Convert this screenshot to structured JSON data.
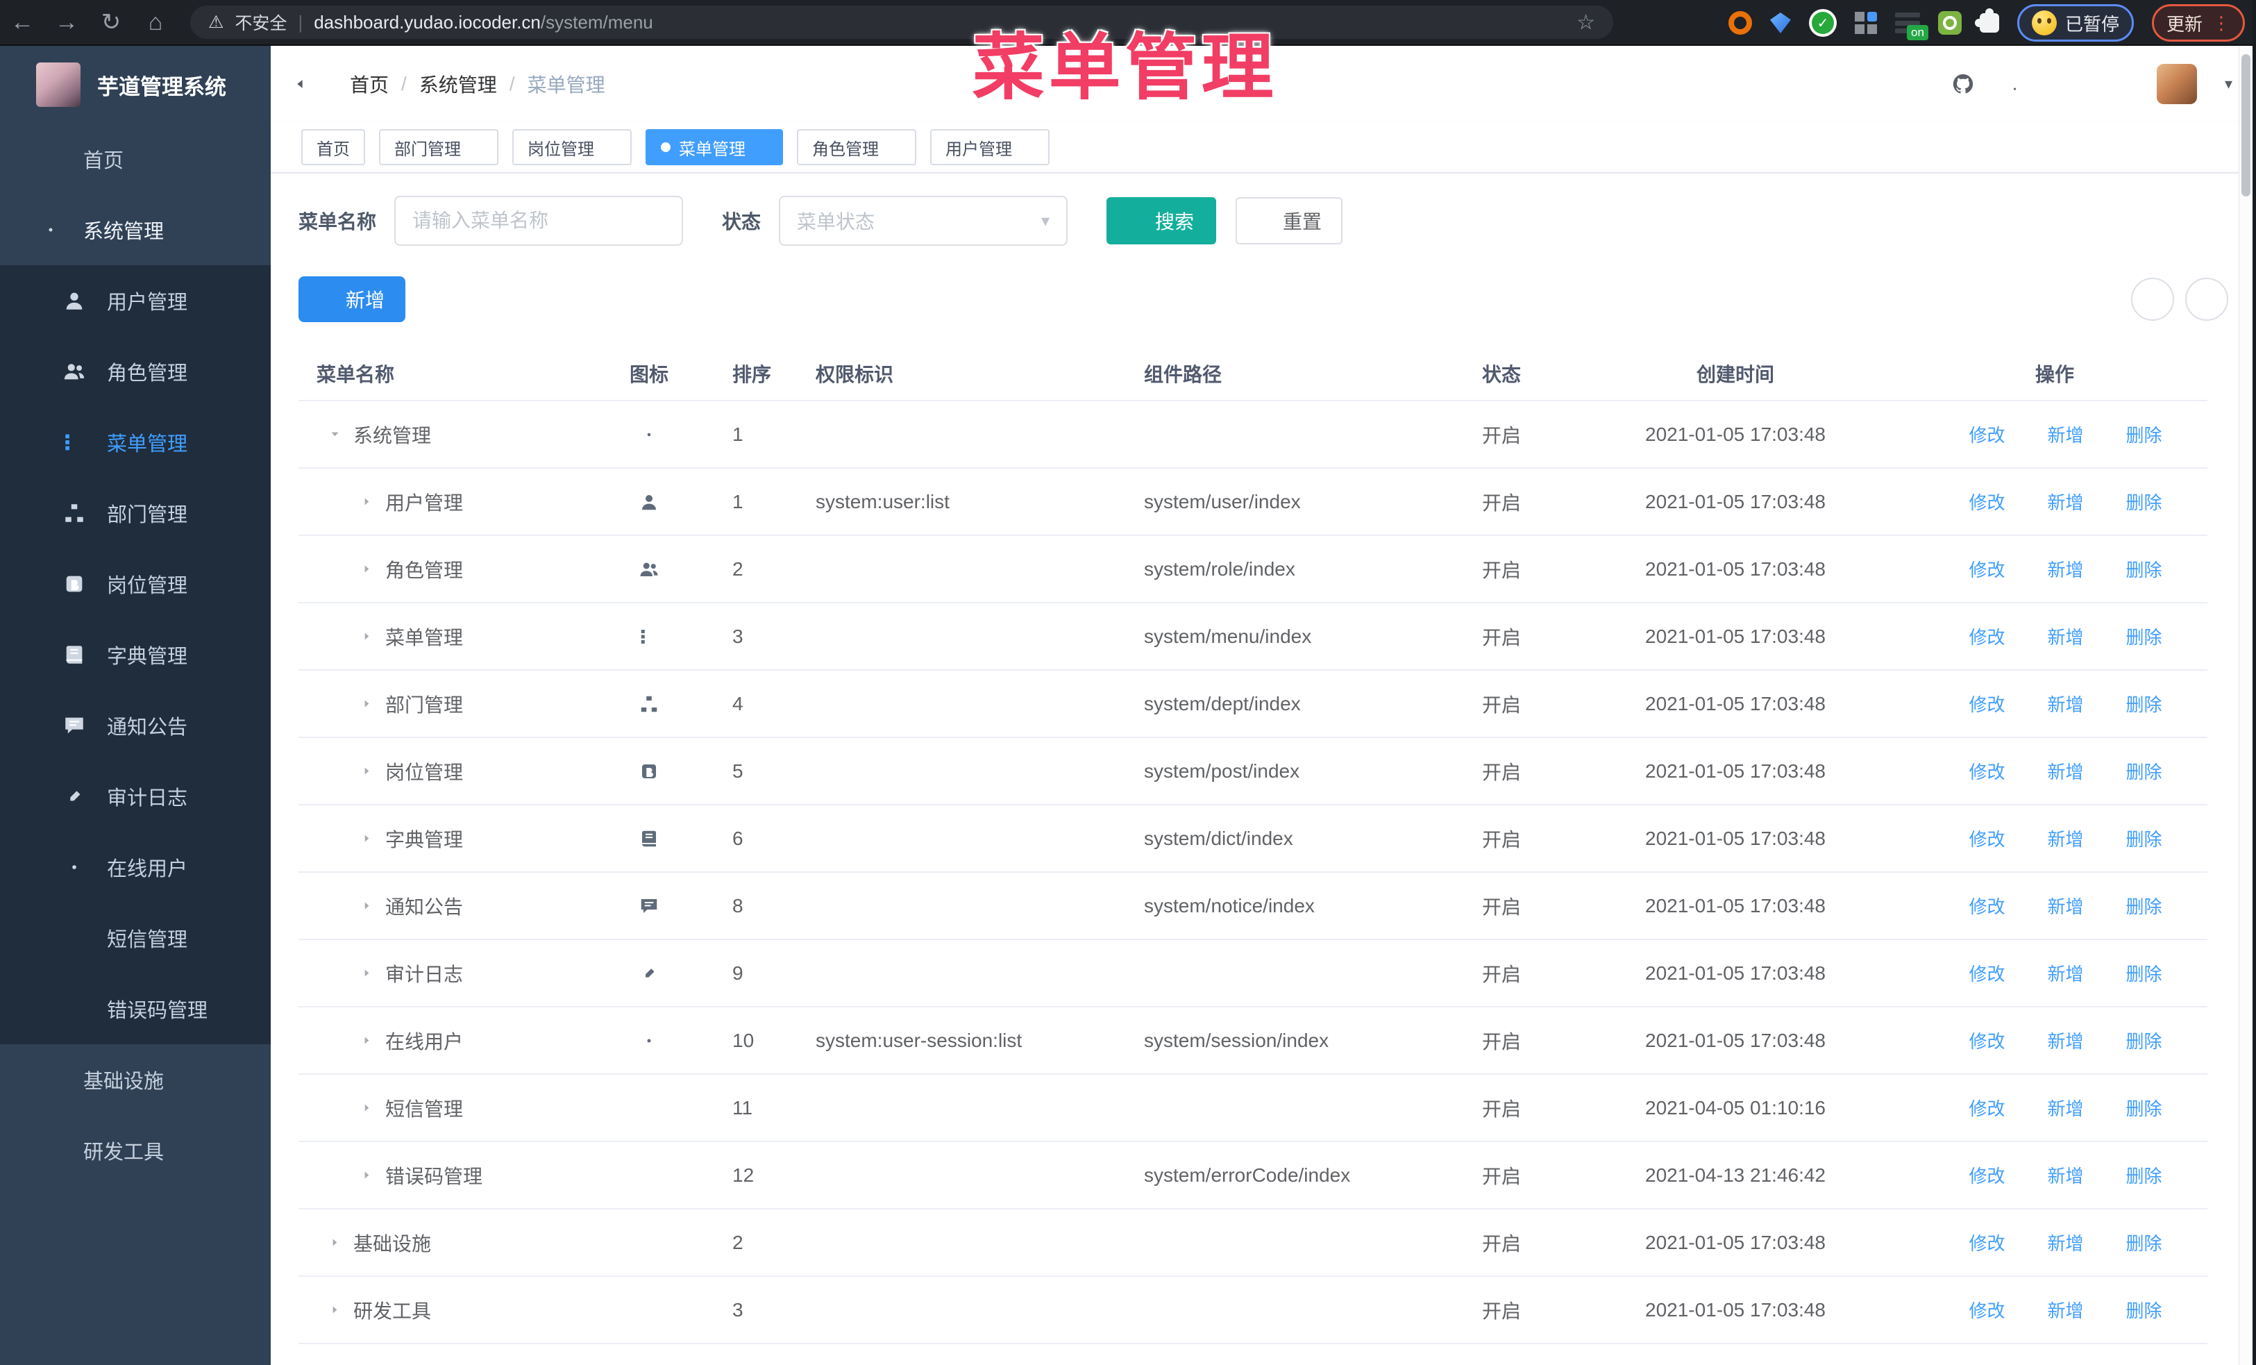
{
  "browser": {
    "security_label": "不安全",
    "url_host": "dashboard.yudao.iocoder.cn",
    "url_path": "/system/menu",
    "extension_on_badge": "on",
    "paused_badge": "已暂停",
    "update_button": "更新"
  },
  "overlay_title": "菜单管理",
  "sidebar": {
    "logo_title": "芋道管理系统",
    "menu": [
      {
        "key": "home",
        "label": "首页",
        "icon": "home-icon",
        "level": 1
      },
      {
        "key": "system",
        "label": "系统管理",
        "icon": "gear-icon",
        "level": 1,
        "arrow": "up",
        "section": true
      },
      {
        "key": "user",
        "label": "用户管理",
        "icon": "user-icon",
        "level": 2
      },
      {
        "key": "role",
        "label": "角色管理",
        "icon": "users-icon",
        "level": 2
      },
      {
        "key": "menu",
        "label": "菜单管理",
        "icon": "menutree-icon",
        "level": 2,
        "active": true
      },
      {
        "key": "dept",
        "label": "部门管理",
        "icon": "orgtree-icon",
        "level": 2
      },
      {
        "key": "post",
        "label": "岗位管理",
        "icon": "post-icon",
        "level": 2
      },
      {
        "key": "dict",
        "label": "字典管理",
        "icon": "dict-icon",
        "level": 2
      },
      {
        "key": "notice",
        "label": "通知公告",
        "icon": "notice-icon",
        "level": 2
      },
      {
        "key": "audit-log",
        "label": "审计日志",
        "icon": "log-icon",
        "level": 2,
        "arrow": "down"
      },
      {
        "key": "online-user",
        "label": "在线用户",
        "icon": "online-icon",
        "level": 2
      },
      {
        "key": "sms",
        "label": "短信管理",
        "icon": "sms-icon",
        "level": 2,
        "arrow": "down"
      },
      {
        "key": "error-code",
        "label": "错误码管理",
        "icon": "code-icon",
        "level": 2
      },
      {
        "key": "infra",
        "label": "基础设施",
        "icon": "infra-icon",
        "level": 1,
        "arrow": "down"
      },
      {
        "key": "devtool",
        "label": "研发工具",
        "icon": "tool-icon",
        "level": 1,
        "arrow": "down"
      }
    ]
  },
  "header": {
    "breadcrumb": [
      "首页",
      "系统管理",
      "菜单管理"
    ]
  },
  "tags": [
    {
      "key": "home",
      "label": "首页",
      "closable": false,
      "active": false
    },
    {
      "key": "dept",
      "label": "部门管理",
      "closable": true,
      "active": false
    },
    {
      "key": "post",
      "label": "岗位管理",
      "closable": true,
      "active": false
    },
    {
      "key": "menu",
      "label": "菜单管理",
      "closable": true,
      "active": true
    },
    {
      "key": "role",
      "label": "角色管理",
      "closable": true,
      "active": false
    },
    {
      "key": "user",
      "label": "用户管理",
      "closable": true,
      "active": false
    }
  ],
  "filters": {
    "name_label": "菜单名称",
    "name_placeholder": "请输入菜单名称",
    "status_label": "状态",
    "status_placeholder": "菜单状态",
    "search_button": "搜索",
    "reset_button": "重置"
  },
  "toolbar": {
    "add_button": "新增"
  },
  "table": {
    "columns": [
      "菜单名称",
      "图标",
      "排序",
      "权限标识",
      "组件路径",
      "状态",
      "创建时间",
      "操作"
    ],
    "actions": {
      "edit": "修改",
      "add": "新增",
      "delete": "删除"
    },
    "rows": [
      {
        "name": "系统管理",
        "level": 1,
        "caret": "down",
        "icon": "gear-icon",
        "sort": "1",
        "perm": "",
        "path": "",
        "status": "开启",
        "time": "2021-01-05 17:03:48"
      },
      {
        "name": "用户管理",
        "level": 2,
        "caret": "right",
        "icon": "user-icon",
        "sort": "1",
        "perm": "system:user:list",
        "path": "system/user/index",
        "status": "开启",
        "time": "2021-01-05 17:03:48"
      },
      {
        "name": "角色管理",
        "level": 2,
        "caret": "right",
        "icon": "users-icon",
        "sort": "2",
        "perm": "",
        "path": "system/role/index",
        "status": "开启",
        "time": "2021-01-05 17:03:48"
      },
      {
        "name": "菜单管理",
        "level": 2,
        "caret": "right",
        "icon": "menutree-icon",
        "sort": "3",
        "perm": "",
        "path": "system/menu/index",
        "status": "开启",
        "time": "2021-01-05 17:03:48"
      },
      {
        "name": "部门管理",
        "level": 2,
        "caret": "right",
        "icon": "orgtree-icon",
        "sort": "4",
        "perm": "",
        "path": "system/dept/index",
        "status": "开启",
        "time": "2021-01-05 17:03:48"
      },
      {
        "name": "岗位管理",
        "level": 2,
        "caret": "right",
        "icon": "post-icon",
        "sort": "5",
        "perm": "",
        "path": "system/post/index",
        "status": "开启",
        "time": "2021-01-05 17:03:48"
      },
      {
        "name": "字典管理",
        "level": 2,
        "caret": "right",
        "icon": "dict-icon",
        "sort": "6",
        "perm": "",
        "path": "system/dict/index",
        "status": "开启",
        "time": "2021-01-05 17:03:48"
      },
      {
        "name": "通知公告",
        "level": 2,
        "caret": "right",
        "icon": "notice-icon",
        "sort": "8",
        "perm": "",
        "path": "system/notice/index",
        "status": "开启",
        "time": "2021-01-05 17:03:48"
      },
      {
        "name": "审计日志",
        "level": 2,
        "caret": "right",
        "icon": "log-icon",
        "sort": "9",
        "perm": "",
        "path": "",
        "status": "开启",
        "time": "2021-01-05 17:03:48"
      },
      {
        "name": "在线用户",
        "level": 2,
        "caret": "right",
        "icon": "online-icon",
        "sort": "10",
        "perm": "system:user-session:list",
        "path": "system/session/index",
        "status": "开启",
        "time": "2021-01-05 17:03:48"
      },
      {
        "name": "短信管理",
        "level": 2,
        "caret": "right",
        "icon": "sms-icon",
        "sort": "11",
        "perm": "",
        "path": "",
        "status": "开启",
        "time": "2021-04-05 01:10:16"
      },
      {
        "name": "错误码管理",
        "level": 2,
        "caret": "right",
        "icon": "code-icon",
        "sort": "12",
        "perm": "",
        "path": "system/errorCode/index",
        "status": "开启",
        "time": "2021-04-13 21:46:42"
      },
      {
        "name": "基础设施",
        "level": 1,
        "caret": "right",
        "icon": "infra-icon",
        "sort": "2",
        "perm": "",
        "path": "",
        "status": "开启",
        "time": "2021-01-05 17:03:48"
      },
      {
        "name": "研发工具",
        "level": 1,
        "caret": "right",
        "icon": "tool-icon",
        "sort": "3",
        "perm": "",
        "path": "",
        "status": "开启",
        "time": "2021-01-05 17:03:48"
      }
    ]
  },
  "colors": {
    "primary_blue": "#409eff",
    "add_button_blue": "#2d8cf0",
    "search_teal": "#14ae9c",
    "overlay_pink": "#f23d64",
    "sidebar_bg": "#304156",
    "sidebar_submenu_bg": "#1f2d3d",
    "link_blue": "#409eff"
  }
}
